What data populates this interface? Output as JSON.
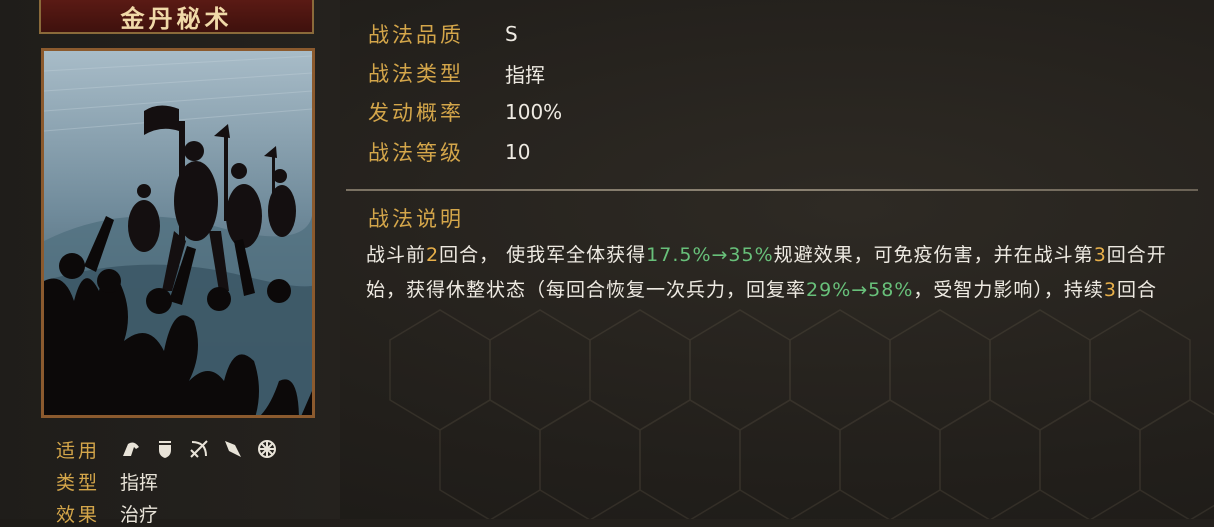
{
  "skill": {
    "name": "金丹秘术",
    "applicable_label": "适用",
    "applicable_icons": [
      "cavalry-icon",
      "shield-icon",
      "bow-icon",
      "spear-icon",
      "wheel-icon"
    ],
    "type_label": "类型",
    "type_value": "指挥",
    "effect_label": "效果",
    "effect_value": "治疗"
  },
  "stats": [
    {
      "label": "战法品质",
      "value": "S"
    },
    {
      "label": "战法类型",
      "value": "指挥"
    },
    {
      "label": "发动概率",
      "value": "100%"
    },
    {
      "label": "战法等级",
      "value": "10"
    }
  ],
  "description": {
    "title": "战法说明",
    "segments": {
      "s1": "战斗前",
      "n1": "2",
      "s2": "回合，  使我军全体获得",
      "r1": "17.5%→35%",
      "s3": "规避效果，可免疫伤害，并在战斗第",
      "n2": "3",
      "s4": "回合开始，获得休整状态（每回合恢复一次兵力，回复率",
      "r2": "29%→58%",
      "s5": "，受智力影响），持续",
      "n3": "3",
      "s6": "回合"
    }
  },
  "colors": {
    "label_gold": "#d4a64a",
    "highlight_green": "#68c07a",
    "highlight_orange": "#e8b04a",
    "title_red": "#5a1a14"
  }
}
